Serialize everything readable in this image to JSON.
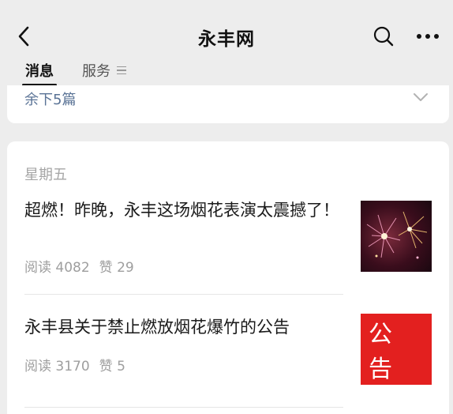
{
  "header": {
    "title": "永丰网",
    "back_icon": "chevron-left-icon",
    "search_icon": "search-icon",
    "more_icon": "more-dots-icon"
  },
  "tabs": [
    {
      "label": "消息",
      "active": true
    },
    {
      "label": "服务",
      "active": false,
      "icon": "menu-icon"
    }
  ],
  "collapsed_card": {
    "remaining_label": "余下5篇",
    "icon": "chevron-down-icon"
  },
  "day_group": {
    "label": "星期五",
    "articles": [
      {
        "title": "超燃！昨晚，永丰这场烟花表演太震撼了！",
        "reads": "阅读 4082",
        "likes": "赞 29",
        "thumbnail": "fireworks-image"
      },
      {
        "title": "永丰县关于禁止燃放烟花爆竹的公告",
        "reads": "阅读 3170",
        "likes": "赞 5",
        "thumbnail": "notice-image",
        "thumbnail_text": "公告"
      }
    ]
  },
  "colors": {
    "background": "#ededed",
    "card": "#ffffff",
    "link_blue": "#5a7396",
    "meta_gray": "#9e9e9e",
    "notice_red": "#e3201f"
  }
}
